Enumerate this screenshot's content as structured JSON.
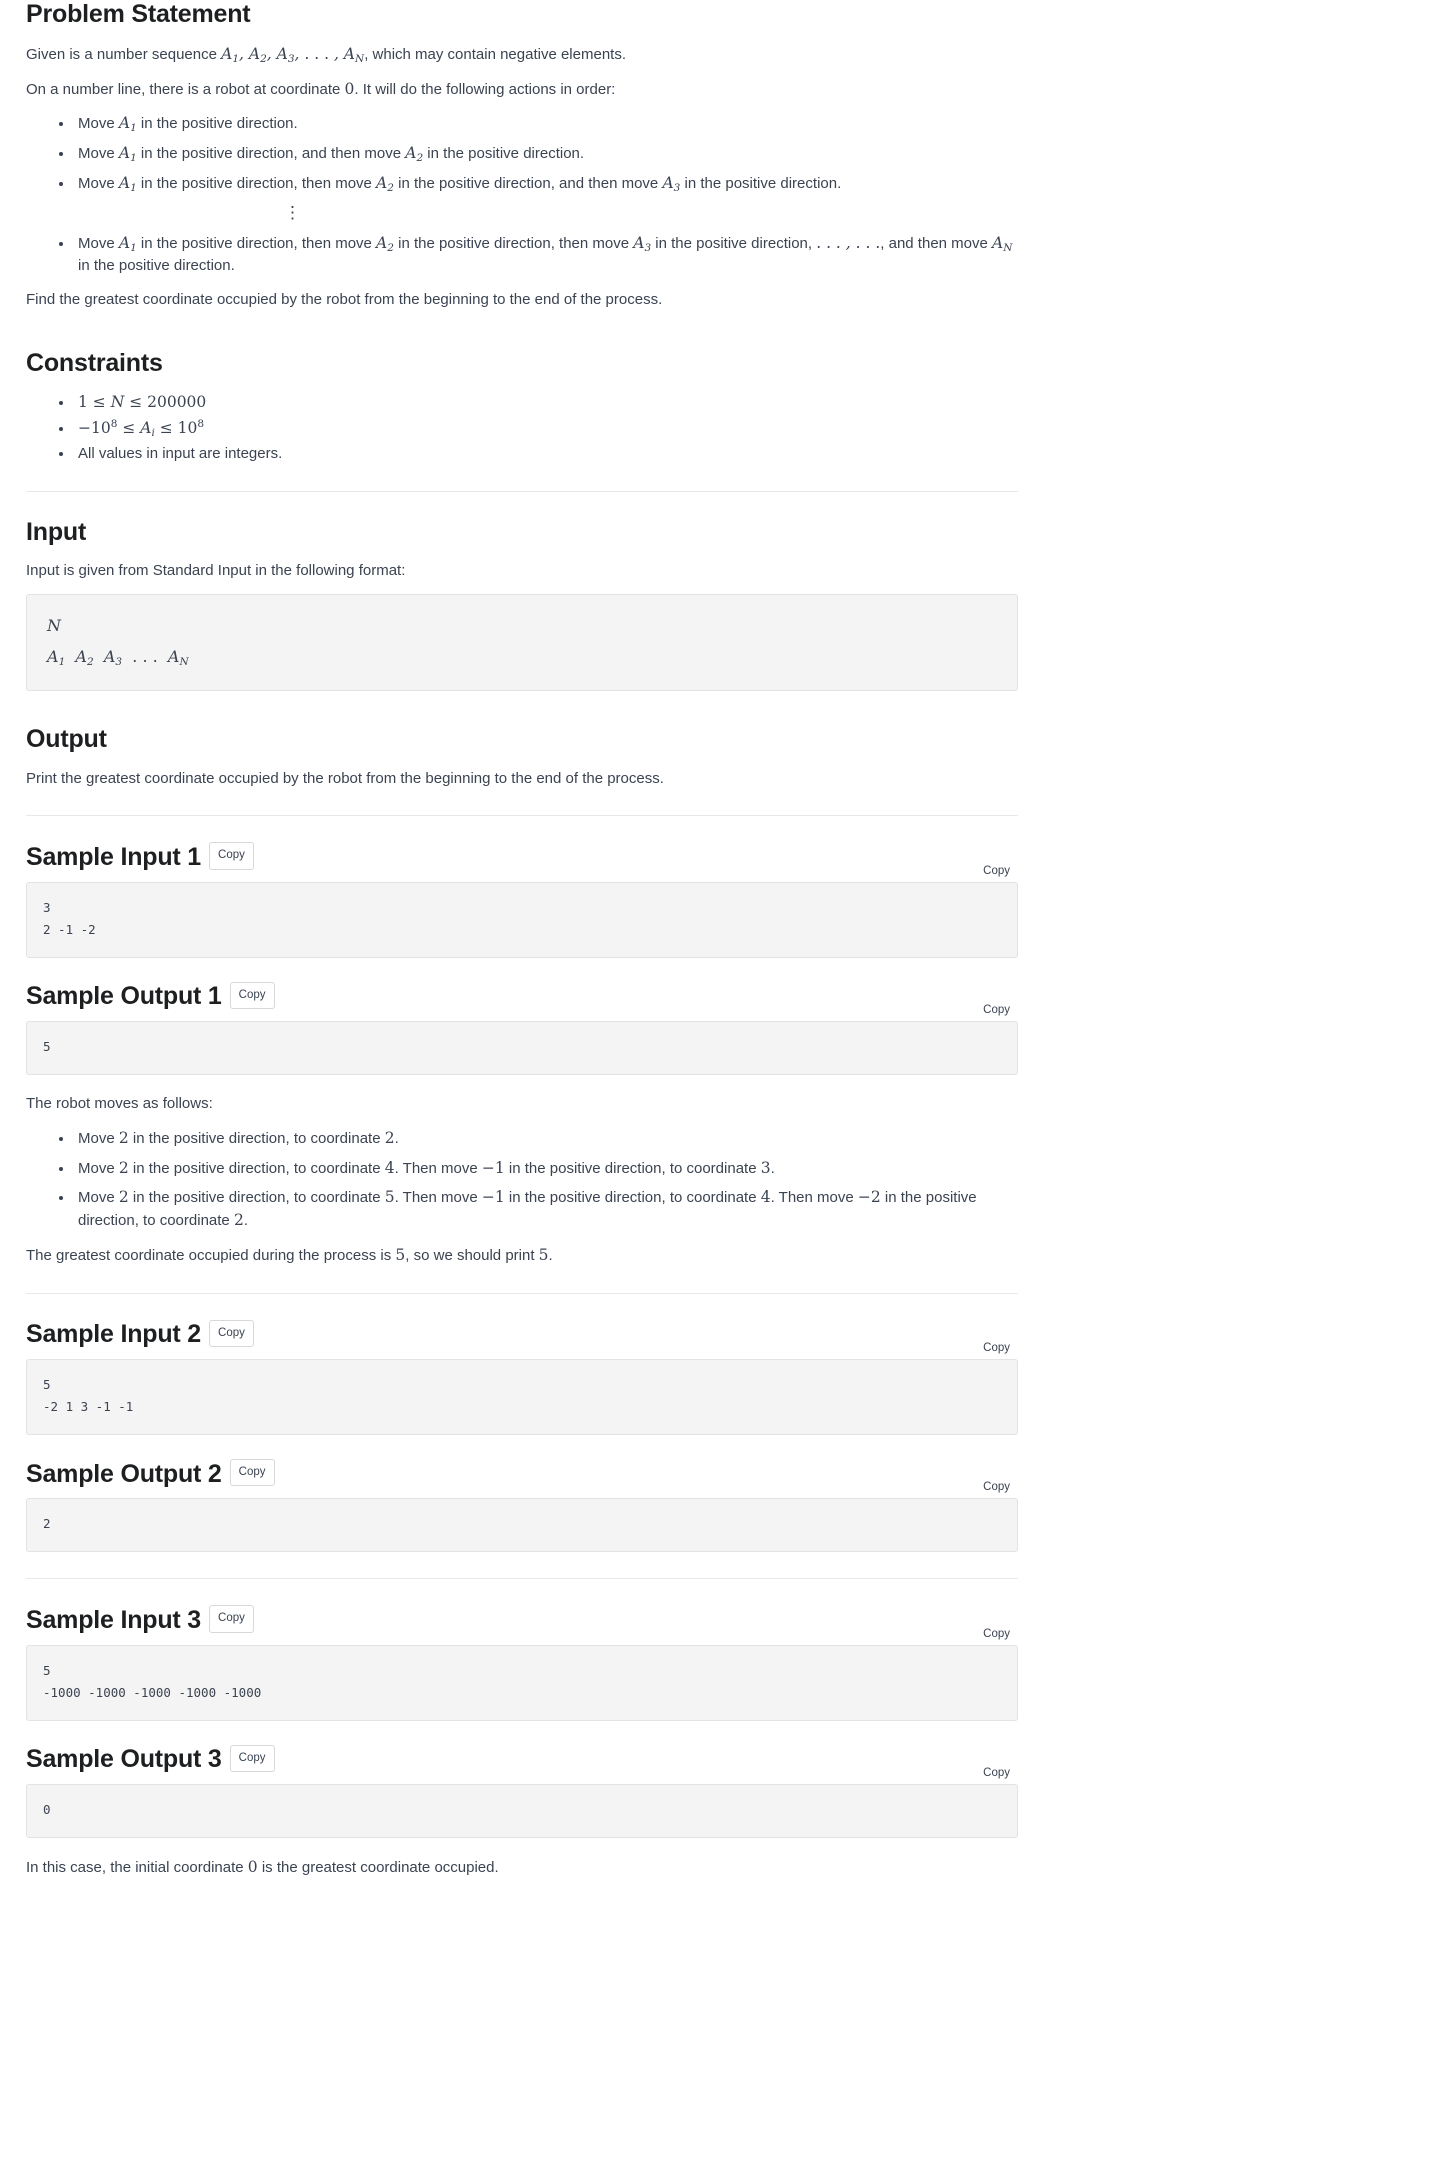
{
  "sections": {
    "problem_statement": {
      "heading": "Problem Statement",
      "p1_a": "Given is a number sequence ",
      "p1_seq": "A₁, A₂, A₃, … , A_N",
      "p1_b": ", which may contain negative elements.",
      "p2": "On a number line, there is a robot at coordinate 0. It will do the following actions in order:",
      "bullets": [
        "Move A₁ in the positive direction.",
        "Move A₁ in the positive direction, and then move A₂ in the positive direction.",
        "Move A₁ in the positive direction, then move A₂ in the positive direction, and then move A₃ in the positive direction.",
        "Move A₁ in the positive direction, then move A₂ in the positive direction, then move A₃ in the positive direction, … , … , and then move A_N in the positive direction."
      ],
      "vdots": "⋮",
      "closing": "Find the greatest coordinate occupied by the robot from the beginning to the end of the process."
    },
    "constraints": {
      "heading": "Constraints",
      "items": [
        "1 ≤ N ≤ 200000",
        "−10⁸ ≤ A_i ≤ 10⁸",
        "All values in input are integers."
      ]
    },
    "input": {
      "heading": "Input",
      "description": "Input is given from Standard Input in the following format:",
      "format_line1": "N",
      "format_line2": "A₁  A₂  A₃  …  A_N"
    },
    "output": {
      "heading": "Output",
      "description": "Print the greatest coordinate occupied by the robot from the beginning to the end of the process."
    }
  },
  "copy_label": "Copy",
  "samples": [
    {
      "input_heading": "Sample Input 1",
      "input_text": "3\n2 -1 -2",
      "output_heading": "Sample Output 1",
      "output_text": "5",
      "explanation_intro": "The robot moves as follows:",
      "explanation_bullets": [
        "Move 2 in the positive direction, to coordinate 2.",
        "Move 2 in the positive direction, to coordinate 4. Then move −1 in the positive direction, to coordinate 3.",
        "Move 2 in the positive direction, to coordinate 5. Then move −1 in the positive direction, to coordinate 4. Then move −2 in the positive direction, to coordinate 2."
      ],
      "explanation_closing": "The greatest coordinate occupied during the process is 5, so we should print 5."
    },
    {
      "input_heading": "Sample Input 2",
      "input_text": "5\n-2 1 3 -1 -1",
      "output_heading": "Sample Output 2",
      "output_text": "2",
      "explanation_intro": "",
      "explanation_bullets": [],
      "explanation_closing": ""
    },
    {
      "input_heading": "Sample Input 3",
      "input_text": "5\n-1000 -1000 -1000 -1000 -1000",
      "output_heading": "Sample Output 3",
      "output_text": "0",
      "explanation_intro": "",
      "explanation_bullets": [],
      "explanation_closing": "In this case, the initial coordinate 0 is the greatest coordinate occupied."
    }
  ],
  "colors": {
    "text": "#3b4351",
    "heading": "#1d1f21",
    "code_bg": "#f4f4f4",
    "border": "#e3e3e3"
  }
}
